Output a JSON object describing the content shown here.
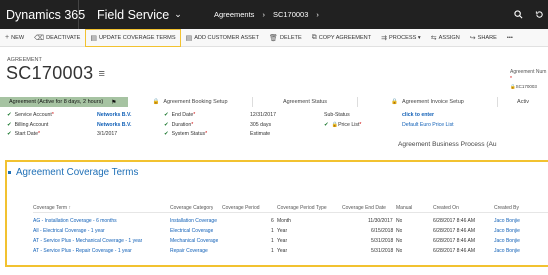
{
  "nav": {
    "brand": "Dynamics 365",
    "app": "Field Service",
    "breadcrumb": [
      "Agreements",
      "SC170003"
    ]
  },
  "commands": [
    {
      "icon": "+",
      "label": "NEW"
    },
    {
      "icon": "⌫",
      "label": "DEACTIVATE"
    },
    {
      "icon": "▤",
      "label": "UPDATE COVERAGE TERMS"
    },
    {
      "icon": "▤",
      "label": "ADD CUSTOMER ASSET"
    },
    {
      "icon": "🗑",
      "label": "DELETE"
    },
    {
      "icon": "⧉",
      "label": "COPY AGREEMENT"
    },
    {
      "icon": "⇉",
      "label": "PROCESS ▾"
    },
    {
      "icon": "⇆",
      "label": "ASSIGN"
    },
    {
      "icon": "↪",
      "label": "SHARE"
    },
    {
      "icon": "",
      "label": "•••"
    }
  ],
  "record": {
    "entity_label": "AGREEMENT",
    "title": "SC170003",
    "right_label": "Agreement Num",
    "right_value": "SC170003"
  },
  "bpf": {
    "active_stage": "Agreement (Active for 8 days, 2 hours)",
    "stages": [
      "Agreement Booking Setup",
      "Agreement Status",
      "Agreement Invoice Setup",
      "Activ"
    ]
  },
  "fields": {
    "col1": [
      {
        "label": "Service Account",
        "value": "Networks B.V."
      },
      {
        "label": "Billing Account",
        "value": "Networks B.V."
      },
      {
        "label": "Start Date",
        "value": "3/1/2017"
      }
    ],
    "col2": [
      {
        "label": "End Date",
        "value": "12/31/2017"
      },
      {
        "label": "Duration",
        "value": "305 days"
      },
      {
        "label": "System Status",
        "value": "Estimate"
      }
    ],
    "col3": [
      {
        "label": "Sub-Status",
        "value": "click to enter"
      },
      {
        "label": "Price List",
        "value": "Default Euro Price List"
      }
    ]
  },
  "bpa_label": "Agreement Business Process (Au",
  "section": {
    "title": "Agreement Coverage Terms",
    "columns": [
      "Coverage Term ↑",
      "Coverage Category",
      "Coverage Period",
      "Coverage Period Type",
      "Coverage End Date",
      "Manual",
      "Created On",
      "Created By"
    ],
    "rows": [
      [
        "AG - Installation Coverage - 6 months",
        "Installation Coverage",
        "6",
        "Month",
        "11/30/2017",
        "No",
        "6/28/2017 8:46 AM",
        "Jaco Bonjie"
      ],
      [
        "All - Electrical Coverage - 1 year",
        "Electrical Coverage",
        "1",
        "Year",
        "6/15/2018",
        "No",
        "6/28/2017 8:46 AM",
        "Jaco Bonjie"
      ],
      [
        "AT - Service Plus - Mechanical Coverage - 1 year",
        "Mechanical Coverage",
        "1",
        "Year",
        "5/31/2018",
        "No",
        "6/28/2017 8:46 AM",
        "Jaco Bonjie"
      ],
      [
        "AT - Service Plus - Repair Coverage - 1 year",
        "Repair Coverage",
        "1",
        "Year",
        "5/31/2018",
        "No",
        "6/28/2017 8:46 AM",
        "Jaco Bonjie"
      ]
    ]
  },
  "colors": {
    "nav_bg": "#212121",
    "accent_link": "#1160b7",
    "highlight": "#f2c230",
    "active_stage": "#a6c3a2",
    "check": "#1e7a32"
  }
}
